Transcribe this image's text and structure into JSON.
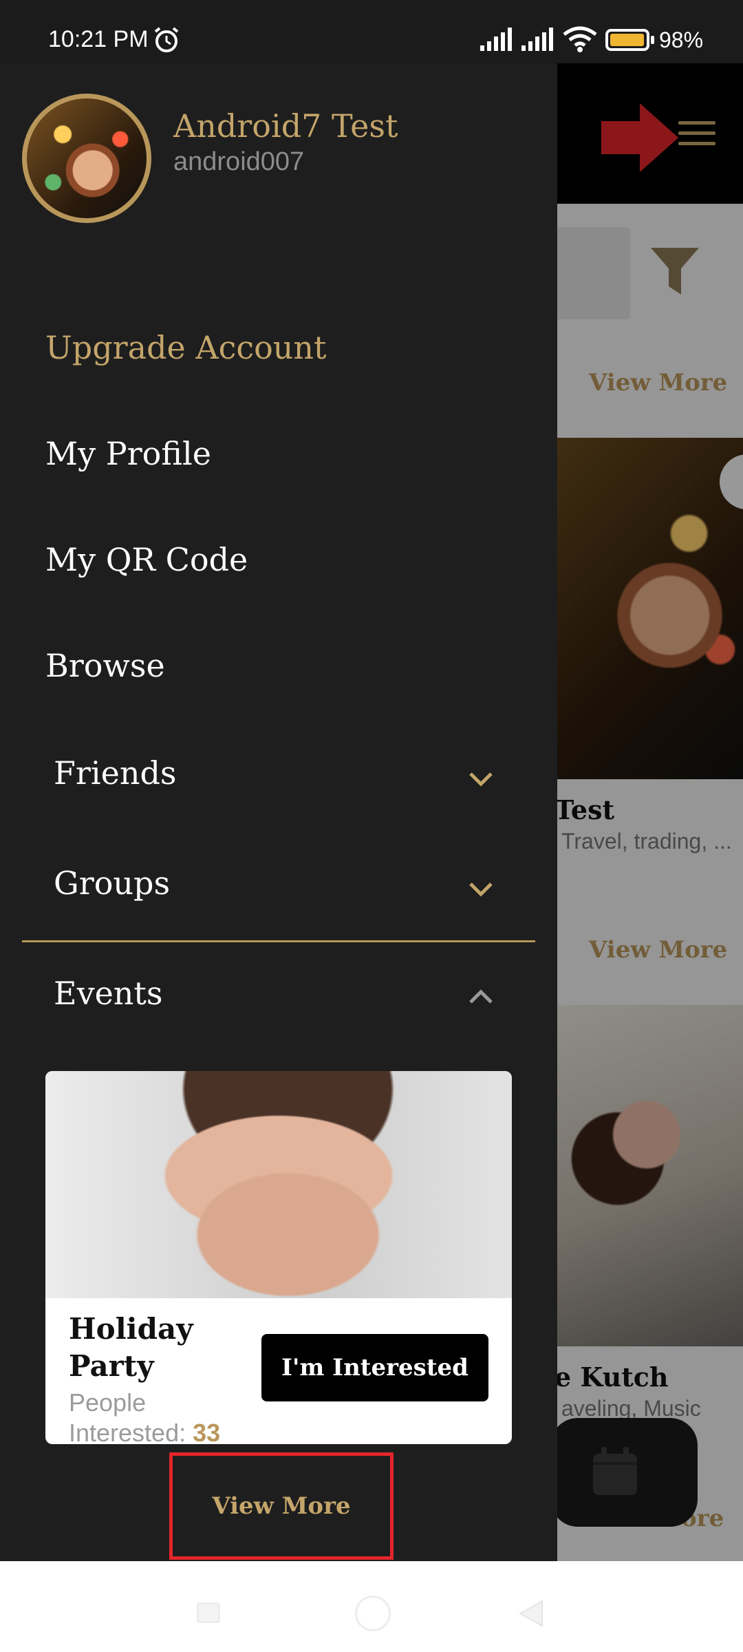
{
  "status_bar": {
    "time": "10:21 PM",
    "battery_level": "98%",
    "battery_fraction": 0.98,
    "icons": [
      "alarm-icon",
      "signal-icon",
      "signal-icon",
      "wifi-icon",
      "battery-icon"
    ]
  },
  "drawer": {
    "user": {
      "name": "Android7 Test",
      "handle": "android007"
    },
    "menu": {
      "upgrade": "Upgrade Account",
      "profile": "My Profile",
      "qr": "My QR Code",
      "browse": "Browse",
      "friends": "Friends",
      "groups": "Groups",
      "events": "Events"
    },
    "event": {
      "title": "Holiday Party",
      "people_label": "People Interested:",
      "people_count": "33",
      "interested_label": "I'm Interested"
    },
    "view_more": "View More"
  },
  "background": {
    "view_more": "View More",
    "card1_name": "Test",
    "card1_interests": "Travel, trading, ...",
    "card2_name": "e Kutch",
    "card2_interests": "aveling, Music",
    "partial_view_more": "ore"
  },
  "colors": {
    "accent_gold": "#c4a56a",
    "drawer_bg": "#1e1e1e",
    "highlight_red": "#e3262a"
  }
}
